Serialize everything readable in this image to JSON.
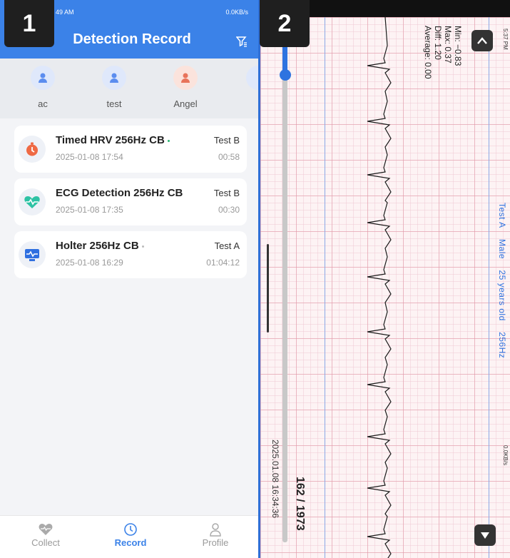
{
  "badges": {
    "one": "1",
    "two": "2"
  },
  "panel1": {
    "status_bar": {
      "time": "49 AM",
      "network": "0.0KB/s"
    },
    "title": "Detection Record",
    "users": [
      {
        "name": "ac",
        "color": "#5b8def"
      },
      {
        "name": "test",
        "color": "#5b8def"
      },
      {
        "name": "Angel",
        "color": "#e8735a"
      }
    ],
    "records": [
      {
        "title": "Timed HRV 256Hz CB",
        "dot_color": "#2bb673",
        "date": "2025-01-08 17:54",
        "user": "Test B",
        "duration": "00:58",
        "icon": "stopwatch-icon"
      },
      {
        "title": "ECG Detection 256Hz CB",
        "dot_color": "",
        "date": "2025-01-08 17:35",
        "user": "Test B",
        "duration": "00:30",
        "icon": "heart-pulse-icon"
      },
      {
        "title": "Holter 256Hz CB",
        "dot_color": "#bbbbbb",
        "date": "2025-01-08 16:29",
        "user": "Test A",
        "duration": "01:04:12",
        "icon": "monitor-pulse-icon"
      }
    ],
    "tabs": [
      {
        "label": "Collect",
        "icon": "heart-icon",
        "active": false
      },
      {
        "label": "Record",
        "icon": "clock-icon",
        "active": true
      },
      {
        "label": "Profile",
        "icon": "person-icon",
        "active": false
      }
    ]
  },
  "panel2": {
    "status_time": "5:37 PM",
    "status_network": "0.0KB/s",
    "stats": {
      "min": "Min: −0.83",
      "max": "Max: 0.37",
      "diff": "Diff: 1.20",
      "average": "Average: 0.00"
    },
    "patient": {
      "name": "Test A",
      "sex": "Male",
      "age": "25 years old",
      "rate": "256Hz"
    },
    "timestamp": "2025.01.08 16:34:36",
    "page_counter": "162 / 1973",
    "grid_color": "#e196a5",
    "accent": "#2e73e0"
  }
}
